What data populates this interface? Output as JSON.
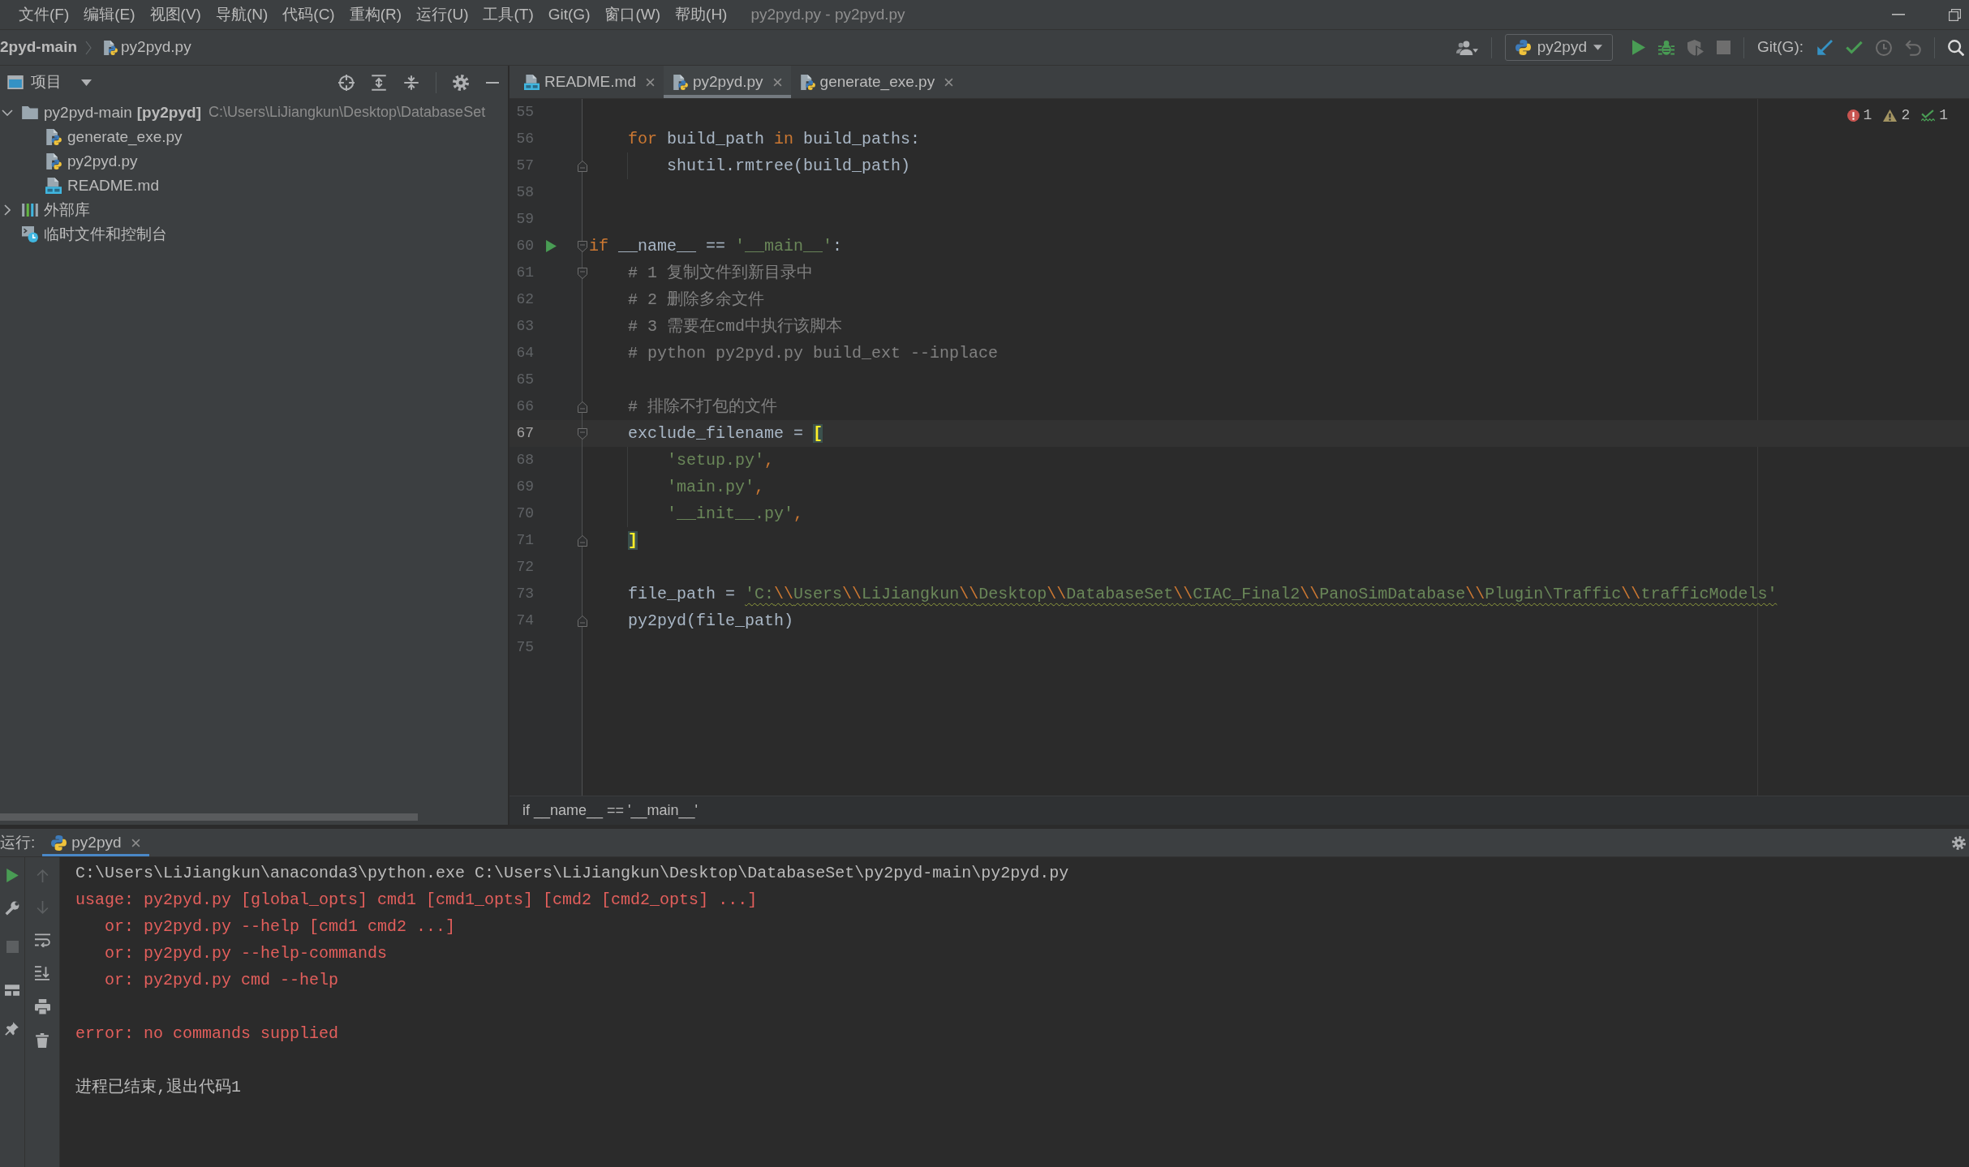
{
  "menu_bar": {
    "items": [
      "文件(F)",
      "编辑(E)",
      "视图(V)",
      "导航(N)",
      "代码(C)",
      "重构(R)",
      "运行(U)",
      "工具(T)",
      "Git(G)",
      "窗口(W)",
      "帮助(H)"
    ],
    "title": "py2pyd.py - py2pyd.py"
  },
  "nav_bar": {
    "breadcrumbs": [
      {
        "label": "2pyd-main",
        "kind": "project"
      },
      {
        "label": "py2pyd.py",
        "kind": "python"
      }
    ],
    "run_configuration": "py2pyd",
    "git_label": "Git(G):"
  },
  "project_panel": {
    "title": "项目",
    "tree": [
      {
        "kind": "folder",
        "label": "py2pyd-main",
        "module": "[py2pyd]",
        "path": "C:\\Users\\LiJiangkun\\Desktop\\DatabaseSet",
        "expanded": true,
        "children": [
          {
            "kind": "python",
            "label": "generate_exe.py"
          },
          {
            "kind": "python",
            "label": "py2pyd.py"
          },
          {
            "kind": "markdown",
            "label": "README.md"
          }
        ]
      },
      {
        "kind": "library",
        "label": "外部库",
        "expanded": false
      },
      {
        "kind": "scratches",
        "label": "临时文件和控制台"
      }
    ]
  },
  "editor": {
    "tabs": [
      {
        "label": "README.md",
        "kind": "markdown",
        "selected": false
      },
      {
        "label": "py2pyd.py",
        "kind": "python",
        "selected": true
      },
      {
        "label": "generate_exe.py",
        "kind": "python",
        "selected": false
      }
    ],
    "inspections": [
      {
        "kind": "error",
        "count": "1"
      },
      {
        "kind": "warning",
        "count": "2"
      },
      {
        "kind": "typo",
        "count": "1"
      }
    ],
    "lines": [
      {
        "number": "55",
        "current": false
      },
      {
        "number": "56",
        "current": false,
        "typo": false,
        "tokens": [
          {
            "kind": "keyword",
            "text": "    for"
          },
          {
            "kind": "plain",
            "text": " build_path "
          },
          {
            "kind": "keyword",
            "text": "in"
          },
          {
            "kind": "plain",
            "text": " build_paths:"
          }
        ]
      },
      {
        "number": "57",
        "current": false,
        "typo": false,
        "gutter": [
          {
            "kind": "fold-end"
          }
        ],
        "tokens": [
          {
            "kind": "plain",
            "text": "        shutil.rmtree(build_path)"
          }
        ]
      },
      {
        "number": "58",
        "current": false
      },
      {
        "number": "59",
        "current": false
      },
      {
        "number": "60",
        "current": false,
        "typo": false,
        "gutter": [
          {
            "kind": "run"
          },
          {
            "kind": "fold-start"
          }
        ],
        "tokens": [
          {
            "kind": "keyword",
            "text": "if"
          },
          {
            "kind": "plain",
            "text": " __name__ == "
          },
          {
            "kind": "string",
            "text": "'__main__'"
          },
          {
            "kind": "plain",
            "text": ":"
          }
        ]
      },
      {
        "number": "61",
        "current": false,
        "typo": false,
        "gutter": [
          {
            "kind": "fold-start"
          }
        ],
        "tokens": [
          {
            "kind": "comment",
            "text": "    # 1 复制文件到新目录中"
          }
        ]
      },
      {
        "number": "62",
        "current": false,
        "typo": false,
        "tokens": [
          {
            "kind": "comment",
            "text": "    # 2 删除多余文件"
          }
        ]
      },
      {
        "number": "63",
        "current": false,
        "typo": false,
        "tokens": [
          {
            "kind": "comment",
            "text": "    # 3 需要在cmd中执行该脚本"
          }
        ]
      },
      {
        "number": "64",
        "current": false,
        "typo": false,
        "tokens": [
          {
            "kind": "comment",
            "text": "    # python py2pyd.py build_ext --inplace"
          }
        ]
      },
      {
        "number": "65",
        "current": false
      },
      {
        "number": "66",
        "current": false,
        "typo": false,
        "gutter": [
          {
            "kind": "fold-end"
          }
        ],
        "tokens": [
          {
            "kind": "comment",
            "text": "    # 排除不打包的文件"
          }
        ]
      },
      {
        "number": "67",
        "current": true,
        "typo": false,
        "gutter": [
          {
            "kind": "fold-start"
          }
        ],
        "tokens": [
          {
            "kind": "plain",
            "text": "    exclude_filename = "
          },
          {
            "kind": "bracket",
            "text": "["
          }
        ]
      },
      {
        "number": "68",
        "current": false,
        "typo": false,
        "tokens": [
          {
            "kind": "string",
            "text": "        'setup.py'"
          },
          {
            "kind": "punct",
            "text": ","
          }
        ]
      },
      {
        "number": "69",
        "current": false,
        "typo": false,
        "tokens": [
          {
            "kind": "string",
            "text": "        'main.py'"
          },
          {
            "kind": "punct",
            "text": ","
          }
        ]
      },
      {
        "number": "70",
        "current": false,
        "typo": false,
        "tokens": [
          {
            "kind": "string",
            "text": "        '__init__.py'"
          },
          {
            "kind": "punct",
            "text": ","
          }
        ]
      },
      {
        "number": "71",
        "current": false,
        "typo": false,
        "gutter": [
          {
            "kind": "fold-end"
          }
        ],
        "tokens": [
          {
            "kind": "bracket",
            "text": "    ]"
          }
        ]
      },
      {
        "number": "72",
        "current": false
      },
      {
        "number": "73",
        "current": false,
        "typo": true,
        "tokens": [
          {
            "kind": "plain",
            "text": "    file_path = "
          },
          {
            "kind": "string",
            "text": "'C:"
          },
          {
            "kind": "escape",
            "text": "\\\\"
          },
          {
            "kind": "string",
            "text": "Users"
          },
          {
            "kind": "escape",
            "text": "\\\\"
          },
          {
            "kind": "string",
            "text": "LiJiangkun"
          },
          {
            "kind": "escape",
            "text": "\\\\"
          },
          {
            "kind": "string",
            "text": "Desktop"
          },
          {
            "kind": "escape",
            "text": "\\\\"
          },
          {
            "kind": "string",
            "text": "DatabaseSet"
          },
          {
            "kind": "escape",
            "text": "\\\\"
          },
          {
            "kind": "string",
            "text": "CIAC_Final2"
          },
          {
            "kind": "escape",
            "text": "\\\\"
          },
          {
            "kind": "string",
            "text": "PanoSimDatabase"
          },
          {
            "kind": "escape",
            "text": "\\\\"
          },
          {
            "kind": "string",
            "text": "Plugin\\Traffic"
          },
          {
            "kind": "escape",
            "text": "\\\\"
          },
          {
            "kind": "string",
            "text": "trafficModels'"
          }
        ]
      },
      {
        "number": "74",
        "current": false,
        "typo": false,
        "gutter": [
          {
            "kind": "fold-end"
          }
        ],
        "tokens": [
          {
            "kind": "plain",
            "text": "    py2pyd(file_path)"
          }
        ]
      },
      {
        "number": "75",
        "current": false
      }
    ],
    "breadcrumb": "if __name__ == '__main__'"
  },
  "run_panel": {
    "label": "运行:",
    "tabs": [
      {
        "label": "py2pyd",
        "selected": true
      }
    ],
    "output": [
      {
        "lines": [
          {
            "kind": "command",
            "text": "C:\\Users\\LiJiangkun\\anaconda3\\python.exe C:\\Users\\LiJiangkun\\Desktop\\DatabaseSet\\py2pyd-main\\py2pyd.py"
          },
          {
            "kind": "stderr",
            "text": "usage: py2pyd.py [global_opts] cmd1 [cmd1_opts] [cmd2 [cmd2_opts] ...]"
          },
          {
            "kind": "stderr",
            "text": "   or: py2pyd.py --help [cmd1 cmd2 ...]"
          },
          {
            "kind": "stderr",
            "text": "   or: py2pyd.py --help-commands"
          },
          {
            "kind": "stderr",
            "text": "   or: py2pyd.py cmd --help"
          }
        ]
      },
      {
        "lines": [
          {
            "kind": "stderr",
            "text": "error: no commands supplied"
          }
        ]
      },
      {
        "lines": [
          {
            "kind": "system",
            "text": "进程已结束,退出代码1"
          }
        ]
      }
    ]
  }
}
